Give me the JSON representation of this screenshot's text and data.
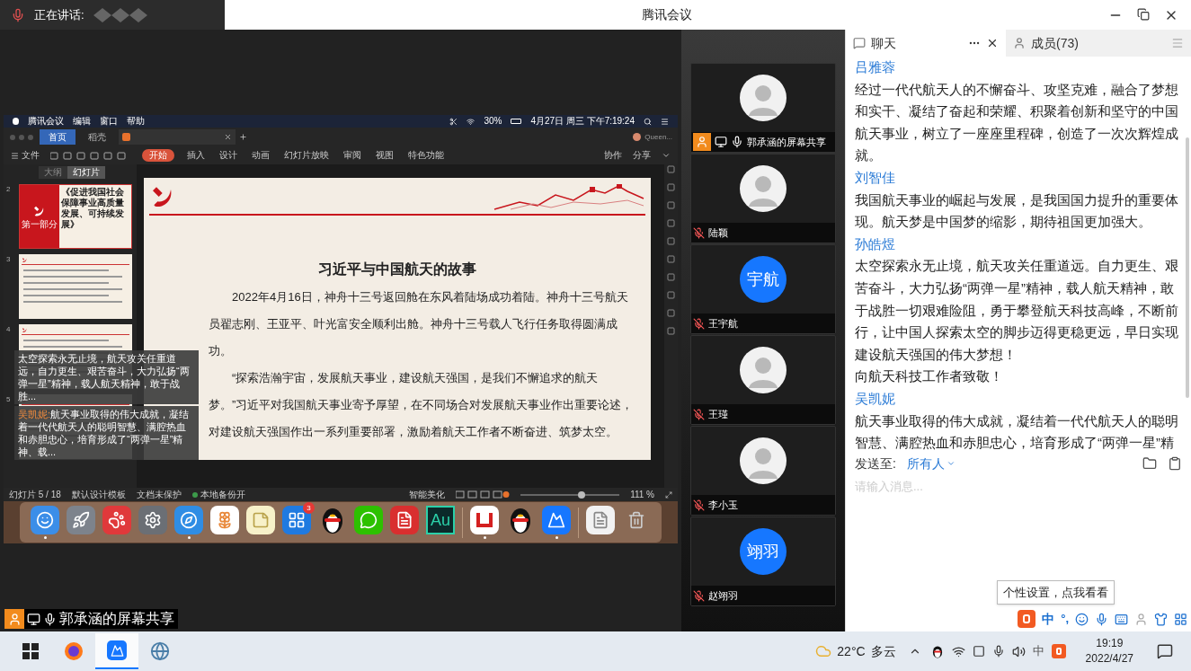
{
  "title_bar": {
    "speaking_label": "正在讲话:",
    "title": "腾讯会议"
  },
  "shared_screen": {
    "menu_bar": {
      "items": [
        "腾讯会议",
        "编辑",
        "窗口",
        "帮助"
      ],
      "battery": "30%",
      "clock": "4月27日 周三 下午7:19:24"
    },
    "doc_tabs": [
      {
        "label": "首页",
        "selected": true
      },
      {
        "label": "稻壳",
        "selected": false
      }
    ],
    "account": "Queen...",
    "ribbon_file": "文件",
    "ribbon_tabs": [
      {
        "label": "开始",
        "selected": true
      },
      {
        "label": "插入",
        "selected": false
      },
      {
        "label": "设计",
        "selected": false
      },
      {
        "label": "动画",
        "selected": false
      },
      {
        "label": "幻灯片放映",
        "selected": false
      },
      {
        "label": "审阅",
        "selected": false
      },
      {
        "label": "视图",
        "selected": false
      },
      {
        "label": "特色功能",
        "selected": false
      }
    ],
    "ribbon_right": [
      "协作",
      "分享"
    ],
    "panel_tabs": [
      {
        "label": "大纲",
        "selected": false
      },
      {
        "label": "幻灯片",
        "selected": true
      }
    ],
    "thumbnails": [
      {
        "number": "2",
        "kind": "cover",
        "section": "第一部分",
        "title": "《促进我国社会保障事业高质量发展、可持续发展》"
      },
      {
        "number": "3",
        "kind": "text"
      },
      {
        "number": "4",
        "kind": "text"
      },
      {
        "number": "5",
        "kind": "text"
      }
    ],
    "slide": {
      "title": "习近平与中国航天的故事",
      "paragraphs": [
        "2022年4月16日，神舟十三号返回舱在东风着陆场成功着陆。神舟十三号航天员翟志刚、王亚平、叶光富安全顺利出舱。神舟十三号载人飞行任务取得圆满成功。",
        "“探索浩瀚宇宙，发展航天事业，建设航天强国，是我们不懈追求的航天梦。”习近平对我国航天事业寄予厚望，在不同场合对发展航天事业作出重要论述，对建设航天强国作出一系列重要部署，激励着航天工作者不断奋进、筑梦太空。"
      ]
    },
    "status_bar": {
      "page": "幻灯片 5 / 18",
      "template": "默认设计模板",
      "protection": "文档未保护",
      "backup": "本地备份开",
      "beautify": "智能美化",
      "zoom": "111 %",
      "level": 0.62
    },
    "dock_groups": [
      {
        "apps": [
          {
            "kind": "finder",
            "running": true
          },
          {
            "kind": "rocket",
            "running": false
          },
          {
            "kind": "bear",
            "running": false
          },
          {
            "kind": "settings",
            "running": false
          },
          {
            "kind": "compass",
            "running": true
          },
          {
            "kind": "photos",
            "running": false
          },
          {
            "kind": "notes",
            "running": false
          },
          {
            "kind": "store",
            "badge": "3",
            "running": false
          },
          {
            "kind": "penguin",
            "running": false
          },
          {
            "kind": "chat",
            "running": false
          },
          {
            "kind": "pdf",
            "running": false
          },
          {
            "kind": "label",
            "label": "Au",
            "running": false
          }
        ]
      },
      {
        "apps": [
          {
            "kind": "wps",
            "running": true
          },
          {
            "kind": "penguin",
            "running": false
          },
          {
            "kind": "meeting",
            "running": true
          }
        ]
      },
      {
        "apps": [
          {
            "kind": "document",
            "running": false
          },
          {
            "kind": "trash",
            "running": false
          }
        ]
      }
    ],
    "overlay_messages": [
      {
        "text": "太空探索永无止境，航天攻关任重道远，自力更生、艰苦奋斗，大力弘扬“两弹一星”精神，载人航天精神，敢于战胜..."
      },
      {
        "name": "吴凯妮:",
        "text": "航天事业取得的伟大成就，凝结着一代代航天人的聪明智慧、满腔热血和赤胆忠心，培育形成了“两弹一星”精神、载..."
      }
    ]
  },
  "share_label": "郭承涵的屏幕共享",
  "participants": [
    {
      "name": "郭承涵的屏幕共享",
      "kind": "sharer",
      "muted": false
    },
    {
      "name": "陆颖",
      "kind": "member",
      "muted": true
    },
    {
      "name": "王宇航",
      "kind": "member",
      "muted": true,
      "avatar": {
        "kind": "text",
        "text": "宇航"
      }
    },
    {
      "name": "王瑾",
      "kind": "member",
      "muted": true
    },
    {
      "name": "李小玉",
      "kind": "member",
      "muted": true
    },
    {
      "name": "赵翊羽",
      "kind": "member",
      "muted": true,
      "avatar": {
        "kind": "text",
        "text": "翊羽"
      }
    }
  ],
  "chat": {
    "tabs": [
      {
        "label": "聊天",
        "kind": "chat",
        "selected": true
      },
      {
        "label": "成员(73)",
        "kind": "members",
        "selected": false
      }
    ],
    "messages": [
      {
        "name": "吕雅蓉",
        "lines": [
          "经过一代代航天人的不懈奋斗、攻坚克难，融合了梦想和实干、凝结了奋起和荣耀、积聚着创新和坚守的中国航天事业，树立了一座座里程碑，创造了一次次辉煌成就。"
        ]
      },
      {
        "name": "刘智佳",
        "lines": [
          "我国航天事业的崛起与发展，是我国国力提升的重要体现。航天梦是中国梦的缩影，期待祖国更加强大。"
        ]
      },
      {
        "name": "孙皓煜",
        "lines": [
          "太空探索永无止境，航天攻关任重道远。自力更生、艰苦奋斗，大力弘扬“两弹一星”精神，载人航天精神，敢于战胜一切艰难险阻，勇于攀登航天科技高峰，不断前行，让中国人探索太空的脚步迈得更稳更远，早日实现建设航天强国的伟大梦想！",
          "向航天科技工作者致敬！"
        ]
      },
      {
        "name": "吴凯妮",
        "lines": [
          "航天事业取得的伟大成就，凝结着一代代航天人的聪明智慧、满腔热血和赤胆忠心，培育形成了“两弹一星”精"
        ]
      }
    ],
    "send_to_label": "发送至:",
    "recipient": "所有人",
    "input_placeholder": "请输入消息..."
  },
  "ime": {
    "tooltip": "个性设置，点我看看",
    "mode": "中",
    "punctuation": "°,"
  },
  "taskbar": {
    "apps": [
      {
        "kind": "start",
        "selected": false
      },
      {
        "kind": "browser",
        "selected": false
      },
      {
        "kind": "meeting",
        "selected": true
      },
      {
        "kind": "globe",
        "selected": false
      }
    ],
    "temperature": "22°C",
    "weather": "多云",
    "input_mode": "中",
    "time": "19:19",
    "date": "2022/4/27"
  }
}
